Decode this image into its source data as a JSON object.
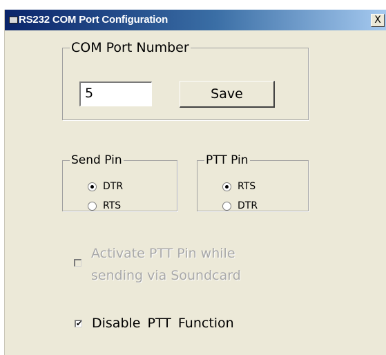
{
  "window": {
    "title": "RS232 COM Port Configuration",
    "close_glyph": "X"
  },
  "com_port": {
    "legend": "COM Port Number",
    "value": "5",
    "save_label": "Save"
  },
  "send_pin": {
    "legend": "Send Pin",
    "options": [
      {
        "label": "DTR",
        "selected": true
      },
      {
        "label": "RTS",
        "selected": false
      }
    ]
  },
  "ptt_pin": {
    "legend": "PTT Pin",
    "options": [
      {
        "label": "RTS",
        "selected": true
      },
      {
        "label": "DTR",
        "selected": false
      }
    ]
  },
  "activate_ptt": {
    "line1": "Activate PTT Pin while",
    "line2": "sending via Soundcard",
    "checked": false,
    "enabled": false
  },
  "disable_ptt": {
    "label": "Disable PTT Function",
    "checked": true,
    "check_glyph": "✔"
  }
}
